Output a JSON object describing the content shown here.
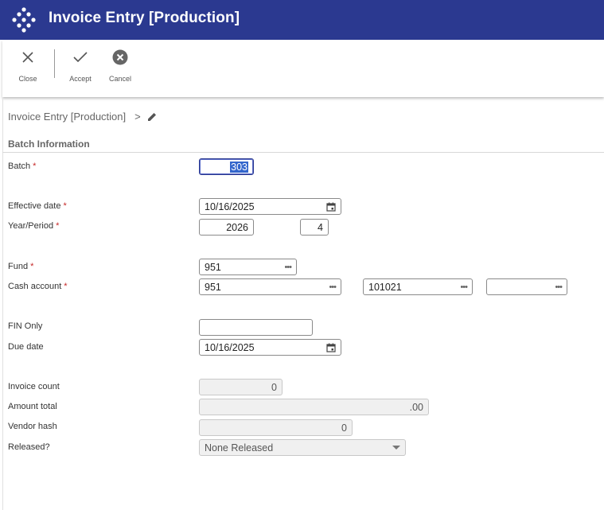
{
  "app": {
    "title": "Invoice Entry [Production]"
  },
  "toolbar": {
    "close_label": "Close",
    "accept_label": "Accept",
    "cancel_label": "Cancel"
  },
  "breadcrumb": {
    "page": "Invoice Entry [Production]",
    "separator": ">"
  },
  "section": {
    "title": "Batch Information"
  },
  "form": {
    "batch": {
      "label": "Batch",
      "value": "303"
    },
    "effective_date": {
      "label": "Effective date",
      "value": "10/16/2025"
    },
    "year_period": {
      "label": "Year/Period",
      "year": "2026",
      "period": "4"
    },
    "fund": {
      "label": "Fund",
      "value": "951"
    },
    "cash_account": {
      "label": "Cash account",
      "fund": "951",
      "account": "101021",
      "extra": ""
    },
    "fin_only": {
      "label": "FIN Only",
      "value": ""
    },
    "due_date": {
      "label": "Due date",
      "value": "10/16/2025"
    },
    "invoice_count": {
      "label": "Invoice count",
      "value": "0"
    },
    "amount_total": {
      "label": "Amount total",
      "value": ".00"
    },
    "vendor_hash": {
      "label": "Vendor hash",
      "value": "0"
    },
    "released": {
      "label": "Released?",
      "value": "None Released"
    }
  },
  "required_marker": "*",
  "colors": {
    "header_bg": "#2b3990",
    "required": "#c62828"
  },
  "icons": [
    "app-logo-icon",
    "close-icon",
    "checkmark-icon",
    "cancel-circle-icon",
    "pencil-icon",
    "calendar-icon",
    "ellipsis-icon",
    "chevron-down-icon"
  ]
}
